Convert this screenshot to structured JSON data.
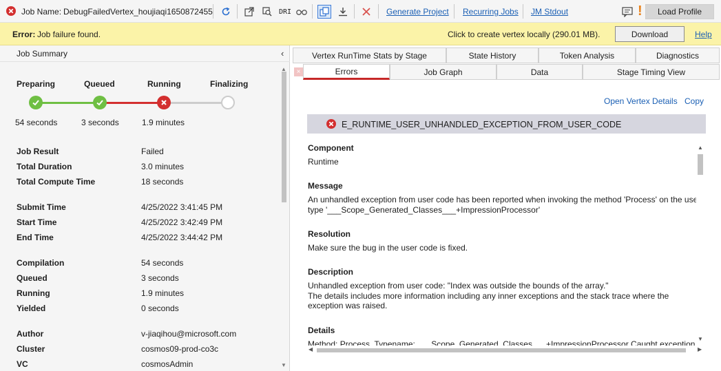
{
  "toolbar": {
    "job_name_label": "Job Name:",
    "job_name": "DebugFailedVertex_houjiaqi1650872455",
    "dri_label": "DRI",
    "generate_project": "Generate Project",
    "recurring_jobs": "Recurring Jobs",
    "jm_stdout": "JM Stdout",
    "warning": "!",
    "load_profile": "Load Profile",
    "icons": [
      "error-icon",
      "refresh-icon",
      "open-external-icon",
      "search-vertex-icon",
      "dri-icon",
      "binoculars-icon",
      "copy-window-icon",
      "download-icon",
      "cancel-icon",
      "feedback-icon"
    ]
  },
  "error_bar": {
    "label": "Error:",
    "message": "Job failure found.",
    "click_text": "Click to create vertex locally (290.01 MB).",
    "download": "Download",
    "help": "Help"
  },
  "summary": {
    "title": "Job Summary",
    "collapse": "‹",
    "stages": [
      {
        "name": "Preparing",
        "time": "54 seconds",
        "status": "done"
      },
      {
        "name": "Queued",
        "time": "3 seconds",
        "status": "done"
      },
      {
        "name": "Running",
        "time": "1.9 minutes",
        "status": "failed"
      },
      {
        "name": "Finalizing",
        "time": "",
        "status": "pending"
      }
    ],
    "rows": [
      {
        "label": "Job Result",
        "value": "Failed"
      },
      {
        "label": "Total Duration",
        "value": "3.0 minutes"
      },
      {
        "label": "Total Compute Time",
        "value": "18 seconds"
      },
      {
        "label": "Submit Time",
        "value": "4/25/2022 3:41:45 PM"
      },
      {
        "label": "Start Time",
        "value": "4/25/2022 3:42:49 PM"
      },
      {
        "label": "End Time",
        "value": "4/25/2022 3:44:42 PM"
      },
      {
        "label": "Compilation",
        "value": "54 seconds"
      },
      {
        "label": "Queued",
        "value": "3 seconds"
      },
      {
        "label": "Running",
        "value": "1.9 minutes"
      },
      {
        "label": "Yielded",
        "value": "0 seconds"
      },
      {
        "label": "Author",
        "value": "v-jiaqihou@microsoft.com"
      },
      {
        "label": "Cluster",
        "value": "cosmos09-prod-co3c"
      },
      {
        "label": "VC",
        "value": "cosmosAdmin"
      }
    ]
  },
  "tabs": {
    "row1": [
      "Vertex RunTime Stats by Stage",
      "State History",
      "Token Analysis",
      "Diagnostics"
    ],
    "row2": [
      "Errors",
      "Job Graph",
      "Data",
      "Stage Timing View"
    ],
    "close": "×"
  },
  "errors_panel": {
    "open_vertex": "Open Vertex Details",
    "copy": "Copy",
    "error_code": "E_RUNTIME_USER_UNHANDLED_EXCEPTION_FROM_USER_CODE",
    "component_h": "Component",
    "component": "Runtime",
    "message_h": "Message",
    "message_1": "An unhandled exception from user code has been reported when invoking the method 'Process' on the user",
    "message_2": "type '___Scope_Generated_Classes___+ImpressionProcessor'",
    "resolution_h": "Resolution",
    "resolution": "Make sure the bug in the user code is fixed.",
    "description_h": "Description",
    "description_1": "Unhandled exception from user code: \"Index was outside the bounds of the array.\"",
    "description_2": "The details includes more information including any inner exceptions and the stack trace where the exception was raised.",
    "details_h": "Details",
    "details": "Method: Process, Typename: ___Scope_Generated_Classes___+ImpressionProcessor          Caught exception"
  },
  "colors": {
    "success": "#4caf50",
    "error": "#d32f2f",
    "pending": "#cccccc",
    "link": "#1a5fb4",
    "error_bar_bg": "#fbf3a8"
  }
}
